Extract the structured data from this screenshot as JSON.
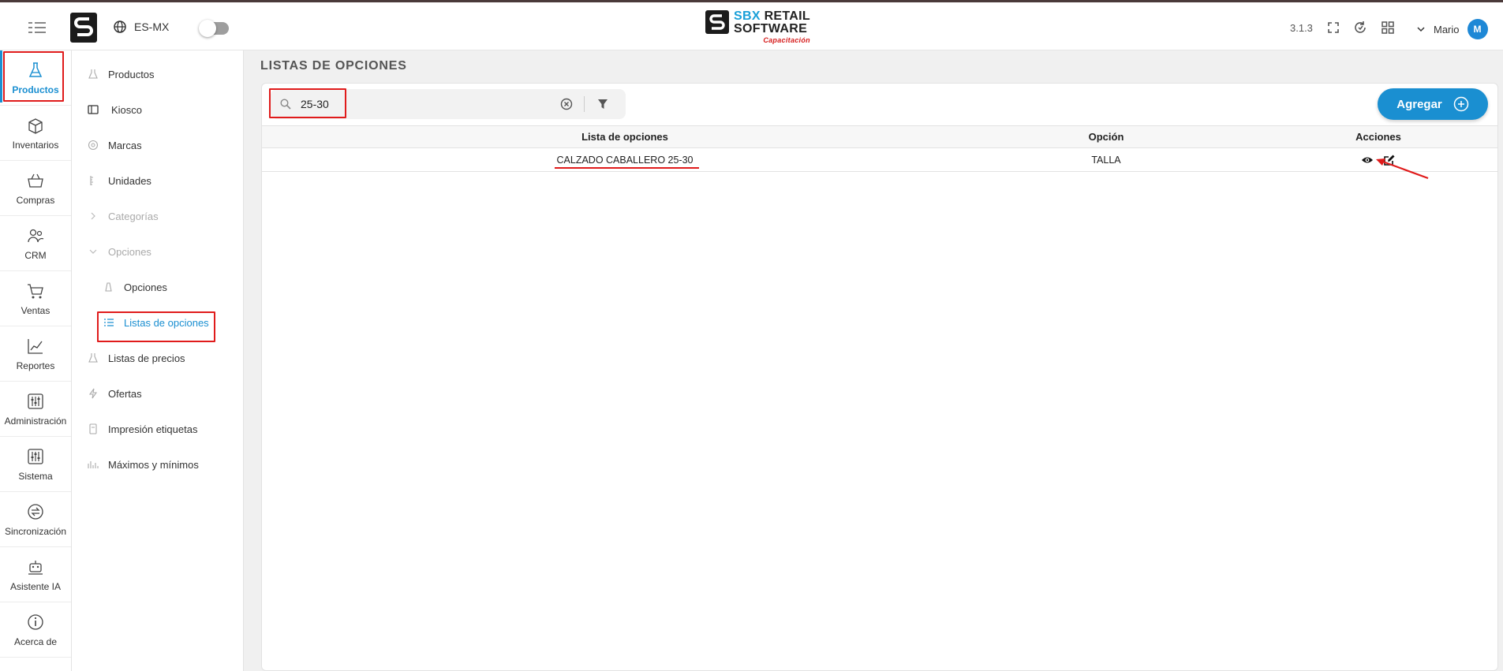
{
  "header": {
    "language": "ES-MX",
    "brand": {
      "sbx": "SBX",
      "retail": "RETAIL",
      "software": "SOFTWARE",
      "subtitle": "Capacitación"
    },
    "version": "3.1.3",
    "user_name": "Mario",
    "user_initial": "M",
    "icons": [
      "menu-icon",
      "globe-icon",
      "fullscreen-icon",
      "sync-icon",
      "apps-grid-icon",
      "chevron-down-icon"
    ]
  },
  "rail": {
    "items": [
      {
        "label": "Productos",
        "icon": "flask-icon",
        "active": true
      },
      {
        "label": "Inventarios",
        "icon": "box-icon"
      },
      {
        "label": "Compras",
        "icon": "basket-icon"
      },
      {
        "label": "CRM",
        "icon": "users-icon"
      },
      {
        "label": "Ventas",
        "icon": "cart-icon"
      },
      {
        "label": "Reportes",
        "icon": "chart-icon"
      },
      {
        "label": "Administración",
        "icon": "sliders-icon"
      },
      {
        "label": "Sistema",
        "icon": "settings-sliders-icon"
      },
      {
        "label": "Sincronización",
        "icon": "sync-circle-icon"
      },
      {
        "label": "Asistente IA",
        "icon": "robot-icon"
      },
      {
        "label": "Acerca de",
        "icon": "info-icon"
      }
    ]
  },
  "submenu": {
    "items": [
      {
        "label": "Productos"
      },
      {
        "label": "Kiosco"
      },
      {
        "label": "Marcas"
      },
      {
        "label": "Unidades"
      },
      {
        "label": "Categorías"
      },
      {
        "label": "Opciones"
      },
      {
        "label": "Opciones"
      },
      {
        "label": "Listas de opciones"
      },
      {
        "label": "Listas de precios"
      },
      {
        "label": "Ofertas"
      },
      {
        "label": "Impresión etiquetas"
      },
      {
        "label": "Máximos y mínimos"
      }
    ]
  },
  "main": {
    "title": "LISTAS DE OPCIONES",
    "search": {
      "value": "25-30"
    },
    "add_label": "Agregar",
    "table": {
      "columns": [
        "Lista de opciones",
        "Opción",
        "Acciones"
      ],
      "rows": [
        {
          "lista": "CALZADO CABALLERO 25-30",
          "opcion": "TALLA"
        }
      ]
    }
  },
  "colors": {
    "accent": "#1a8fd1",
    "annotation": "#e01b1b",
    "brand_red": "#d61c1c"
  }
}
